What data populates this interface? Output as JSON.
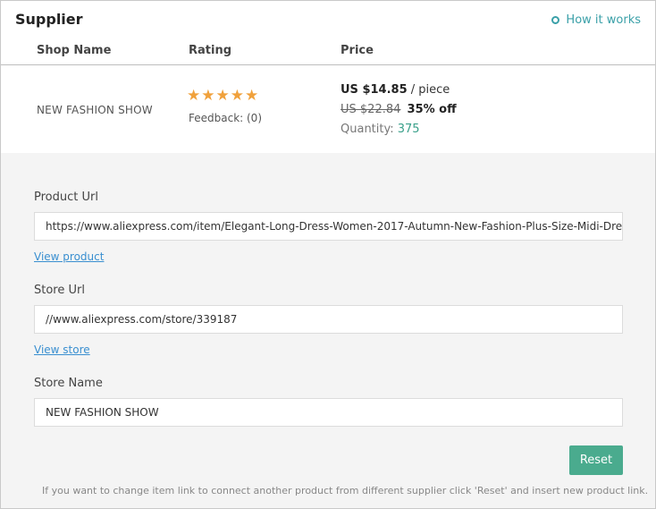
{
  "header": {
    "title": "Supplier",
    "how_it_works": "How it works"
  },
  "columns": {
    "shop_name": "Shop Name",
    "rating": "Rating",
    "price": "Price"
  },
  "supplier": {
    "shop_name": "NEW FASHION SHOW",
    "rating_stars": 5,
    "feedback": "Feedback: (0)",
    "price": "US $14.85",
    "price_unit": "/ piece",
    "old_price": "US $22.84",
    "discount": "35% off",
    "quantity_label": "Quantity:",
    "quantity": "375"
  },
  "form": {
    "product_url_label": "Product Url",
    "product_url": "https://www.aliexpress.com/item/Elegant-Long-Dress-Women-2017-Autumn-New-Fashion-Plus-Size-Midi-Dre",
    "view_product": "View product",
    "store_url_label": "Store Url",
    "store_url": "//www.aliexpress.com/store/339187",
    "view_store": "View store",
    "store_name_label": "Store Name",
    "store_name": "NEW FASHION SHOW",
    "reset_label": "Reset",
    "note": "If you want to change item link to connect another product from different supplier click 'Reset' and insert new product link."
  },
  "colors": {
    "accent_teal": "#3aa0a8",
    "star": "#f0a13c",
    "reset_button": "#4aab8e",
    "link": "#3a8fd0"
  }
}
